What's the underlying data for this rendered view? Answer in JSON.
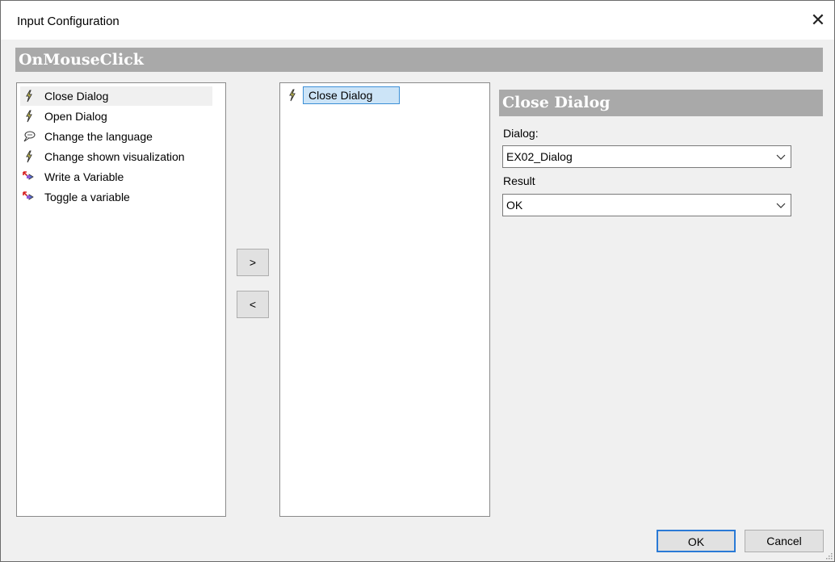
{
  "window": {
    "title": "Input Configuration",
    "close_glyph": "✕"
  },
  "event": {
    "name": "OnMouseClick"
  },
  "available_actions": [
    {
      "label": "Close Dialog",
      "icon": "lightning-icon",
      "selected": true
    },
    {
      "label": "Open Dialog",
      "icon": "lightning-icon"
    },
    {
      "label": "Change the language",
      "icon": "speech-bubble-icon"
    },
    {
      "label": "Change shown visualization",
      "icon": "lightning-icon"
    },
    {
      "label": "Write a Variable",
      "icon": "variable-arrow-icon"
    },
    {
      "label": "Toggle a variable",
      "icon": "variable-arrow-icon"
    }
  ],
  "configured_actions": [
    {
      "label": "Close Dialog",
      "icon": "lightning-icon"
    }
  ],
  "move_buttons": {
    "add_label": ">",
    "remove_label": "<"
  },
  "properties": {
    "title": "Close Dialog",
    "dialog_label": "Dialog:",
    "dialog_value": "EX02_Dialog",
    "result_label": "Result",
    "result_value": "OK"
  },
  "footer": {
    "ok_label": "OK",
    "cancel_label": "Cancel"
  },
  "colors": {
    "header_bg": "#a9a9a9",
    "selection_bg": "#cce4f7",
    "selection_border": "#3c8fd6",
    "default_button_border": "#2a7ad6"
  }
}
